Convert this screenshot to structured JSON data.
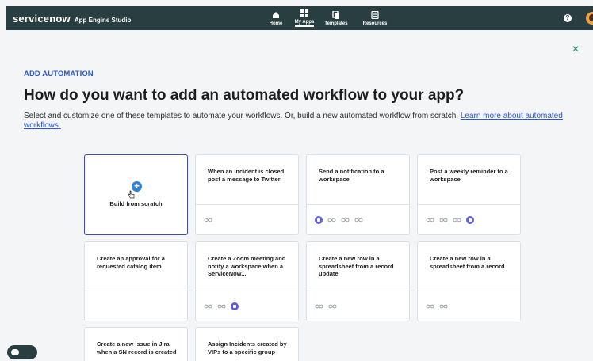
{
  "header": {
    "logo": "servicenow",
    "app_name": "App Engine Studio",
    "nav": [
      {
        "label": "Home",
        "icon": "home-icon"
      },
      {
        "label": "My Apps",
        "icon": "grid-icon",
        "active": true
      },
      {
        "label": "Templates",
        "icon": "templates-icon"
      },
      {
        "label": "Resources",
        "icon": "resources-icon"
      }
    ],
    "help": "?",
    "bg_color": "#293e40"
  },
  "close_label": "×",
  "eyebrow": "ADD AUTOMATION",
  "heading": "How do you want to add an automated workflow to your app?",
  "description": {
    "text": "Select and customize one of these templates to automate your workflows. Or, build a new automated workflow from scratch. ",
    "link": "Learn more about automated workflows."
  },
  "scratch_card": {
    "label": "Build from scratch"
  },
  "cards": [
    {
      "title": "When an incident is closed, post a message to Twitter",
      "icons": [
        "loop"
      ]
    },
    {
      "title": "Send a notification to a workspace",
      "icons": [
        "workspace",
        "loop",
        "loop",
        "loop"
      ]
    },
    {
      "title": "Post a weekly reminder to a workspace",
      "icons": [
        "loop",
        "loop",
        "loop",
        "workspace"
      ]
    },
    {
      "title": "Create an approval for a requested catalog item",
      "icons": []
    },
    {
      "title": "Create a Zoom meeting and notify a workspace when a ServiceNow...",
      "icons": [
        "loop",
        "loop",
        "workspace"
      ]
    },
    {
      "title": "Create a new row in a spreadsheet from a record update",
      "icons": [
        "loop",
        "loop"
      ]
    },
    {
      "title": "Create a new row in a spreadsheet from a record",
      "icons": [
        "loop",
        "loop"
      ]
    },
    {
      "title": "Create a new issue in Jira when a SN record is created",
      "icons": []
    },
    {
      "title": "Assign Incidents created by VIPs to a specific group",
      "icons": []
    }
  ],
  "colors": {
    "accent": "#2a57d2",
    "workspace": "#5f5fd6",
    "plus": "#2d82d6"
  }
}
